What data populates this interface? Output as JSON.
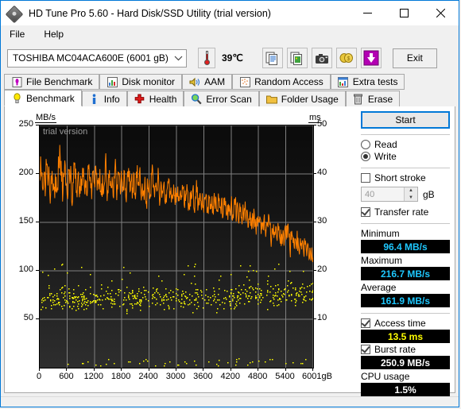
{
  "window": {
    "title": "HD Tune Pro 5.60 - Hard Disk/SSD Utility (trial version)",
    "app_icon": "hard-disk-icon",
    "minimize_label": "Minimize",
    "maximize_label": "Maximize",
    "close_label": "Close"
  },
  "menu": {
    "items": [
      {
        "label": "File"
      },
      {
        "label": "Help"
      }
    ]
  },
  "toolbar": {
    "drive": "TOSHIBA MC04ACA600E (6001 gB)",
    "drive_chevron": "chevron-down-icon",
    "temperature": "39℃",
    "thermometer_icon": "thermometer-icon",
    "buttons": [
      {
        "name": "copy-text-icon",
        "tooltip": "Copy text"
      },
      {
        "name": "copy-image-icon",
        "tooltip": "Copy image"
      },
      {
        "name": "screenshot-camera-icon",
        "tooltip": "Screenshot"
      },
      {
        "name": "buy-money-icon",
        "tooltip": "Buy"
      },
      {
        "name": "download-arrow-icon",
        "tooltip": "Download"
      }
    ],
    "exit_label": "Exit"
  },
  "tabs": {
    "row1": [
      {
        "label": "File Benchmark",
        "icon": "file-benchmark-icon",
        "active": false
      },
      {
        "label": "Disk monitor",
        "icon": "disk-monitor-icon",
        "active": false
      },
      {
        "label": "AAM",
        "icon": "speaker-icon",
        "active": false
      },
      {
        "label": "Random Access",
        "icon": "random-access-icon",
        "active": false
      },
      {
        "label": "Extra tests",
        "icon": "extra-tests-icon",
        "active": false
      }
    ],
    "row2": [
      {
        "label": "Benchmark",
        "icon": "lightbulb-icon",
        "active": true
      },
      {
        "label": "Info",
        "icon": "info-icon",
        "active": false
      },
      {
        "label": "Health",
        "icon": "health-cross-icon",
        "active": false
      },
      {
        "label": "Error Scan",
        "icon": "magnifier-icon",
        "active": false
      },
      {
        "label": "Folder Usage",
        "icon": "folder-icon",
        "active": false
      },
      {
        "label": "Erase",
        "icon": "trash-icon",
        "active": false
      }
    ]
  },
  "panel": {
    "start_label": "Start",
    "mode": {
      "read_label": "Read",
      "write_label": "Write",
      "selected": "Write"
    },
    "short_stroke": {
      "label": "Short stroke",
      "checked": false,
      "value": "40",
      "unit": "gB"
    },
    "transfer_rate": {
      "label": "Transfer rate",
      "checked": true
    },
    "minimum": {
      "label": "Minimum",
      "value": "96.4 MB/s"
    },
    "maximum": {
      "label": "Maximum",
      "value": "216.7 MB/s"
    },
    "average": {
      "label": "Average",
      "value": "161.9 MB/s"
    },
    "access_time": {
      "label": "Access time",
      "checked": true,
      "value": "13.5 ms"
    },
    "burst_rate": {
      "label": "Burst rate",
      "checked": true,
      "value": "250.9 MB/s"
    },
    "cpu_usage": {
      "label": "CPU usage",
      "value": "1.5%"
    }
  },
  "chart_data": {
    "type": "line",
    "title": "",
    "watermark": "trial version",
    "ylabel_left": "MB/s",
    "ylabel_right": "ms",
    "xlabel": "",
    "grid": true,
    "xlim": [
      0,
      6001
    ],
    "ylim_left": [
      0,
      250
    ],
    "ylim_right": [
      0,
      50
    ],
    "xticks": [
      0,
      600,
      1200,
      1800,
      2400,
      3000,
      3600,
      4200,
      4800,
      5400,
      6001
    ],
    "xtick_labels": [
      "0",
      "600",
      "1200",
      "1800",
      "2400",
      "3000",
      "3600",
      "4200",
      "4800",
      "5400",
      "6001gB"
    ],
    "yticks_left": [
      50,
      100,
      150,
      200,
      250
    ],
    "yticks_right": [
      10,
      20,
      30,
      40,
      50
    ],
    "colors": {
      "transfer_rate": "#ff8000",
      "access_time": "#ffff00",
      "grid": "#808080",
      "background": "#111111"
    },
    "series": [
      {
        "name": "Transfer rate",
        "unit": "MB/s",
        "axis": "left",
        "color": "#ff8000",
        "x": [
          0,
          30,
          60,
          90,
          120,
          150,
          180,
          210,
          240,
          270,
          300,
          330,
          360,
          390,
          420,
          450,
          480,
          510,
          540,
          570,
          600,
          630,
          660,
          690,
          720,
          750,
          780,
          810,
          840,
          870,
          900,
          930,
          960,
          990,
          1020,
          1050,
          1080,
          1110,
          1140,
          1170,
          1200,
          1230,
          1260,
          1290,
          1320,
          1350,
          1380,
          1410,
          1440,
          1470,
          1500,
          1530,
          1560,
          1590,
          1620,
          1650,
          1680,
          1710,
          1740,
          1770,
          1800,
          1830,
          1860,
          1890,
          1920,
          1950,
          1980,
          2010,
          2040,
          2070,
          2100,
          2130,
          2160,
          2190,
          2220,
          2250,
          2280,
          2310,
          2340,
          2370,
          2400,
          2430,
          2460,
          2490,
          2520,
          2550,
          2580,
          2610,
          2640,
          2670,
          2700,
          2730,
          2760,
          2790,
          2820,
          2850,
          2880,
          2910,
          2940,
          2970,
          3000,
          3030,
          3060,
          3090,
          3120,
          3150,
          3180,
          3210,
          3240,
          3270,
          3300,
          3330,
          3360,
          3390,
          3420,
          3450,
          3480,
          3510,
          3540,
          3570,
          3600,
          3630,
          3660,
          3690,
          3720,
          3750,
          3780,
          3810,
          3840,
          3870,
          3900,
          3930,
          3960,
          3990,
          4020,
          4050,
          4080,
          4110,
          4140,
          4170,
          4200,
          4230,
          4260,
          4290,
          4320,
          4350,
          4380,
          4410,
          4440,
          4470,
          4500,
          4530,
          4560,
          4590,
          4620,
          4650,
          4680,
          4710,
          4740,
          4770,
          4800,
          4830,
          4860,
          4890,
          4920,
          4950,
          4980,
          5010,
          5040,
          5070,
          5100,
          5130,
          5160,
          5190,
          5220,
          5250,
          5280,
          5310,
          5340,
          5370,
          5400,
          5430,
          5460,
          5490,
          5520,
          5550,
          5580,
          5610,
          5640,
          5670,
          5700,
          5730,
          5760,
          5790,
          5820,
          5850,
          5880,
          5910,
          5940,
          5970,
          6001
        ],
        "y": [
          193,
          204,
          186,
          198,
          177,
          209,
          188,
          196,
          181,
          203,
          190,
          175,
          197,
          186,
          208,
          216,
          192,
          180,
          201,
          188,
          178,
          205,
          190,
          196,
          172,
          212,
          195,
          183,
          200,
          176,
          198,
          188,
          206,
          179,
          193,
          185,
          210,
          197,
          174,
          202,
          190,
          208,
          183,
          196,
          205,
          178,
          199,
          187,
          213,
          192,
          180,
          204,
          188,
          197,
          175,
          206,
          190,
          184,
          201,
          179,
          195,
          187,
          203,
          176,
          198,
          206,
          182,
          193,
          186,
          200,
          174,
          196,
          188,
          202,
          179,
          190,
          183,
          197,
          171,
          185,
          194,
          178,
          200,
          186,
          176,
          191,
          183,
          195,
          172,
          188,
          180,
          192,
          169,
          183,
          191,
          175,
          186,
          178,
          189,
          168,
          180,
          187,
          172,
          183,
          176,
          186,
          165,
          178,
          183,
          170,
          181,
          174,
          184,
          163,
          176,
          181,
          168,
          178,
          172,
          180,
          160,
          174,
          178,
          166,
          175,
          169,
          177,
          158,
          171,
          175,
          163,
          172,
          166,
          174,
          155,
          168,
          172,
          160,
          169,
          163,
          170,
          152,
          164,
          168,
          156,
          165,
          159,
          166,
          148,
          159,
          163,
          151,
          160,
          154,
          161,
          143,
          154,
          158,
          147,
          155,
          150,
          156,
          138,
          149,
          153,
          142,
          150,
          145,
          151,
          133,
          144,
          148,
          137,
          145,
          140,
          146,
          128,
          138,
          142,
          131,
          139,
          134,
          140,
          122,
          132,
          136,
          126,
          133,
          128,
          134,
          117,
          126,
          130,
          120,
          127,
          122,
          128,
          112,
          120,
          124,
          114,
          121,
          116,
          122,
          106,
          114,
          118,
          108,
          115,
          110,
          116,
          100,
          108,
          112,
          104,
          110,
          98
        ]
      },
      {
        "name": "Access time",
        "unit": "ms",
        "axis": "right",
        "color": "#ffff00",
        "marker": "dot",
        "average": 13.5,
        "cluster_range_ms": [
          11,
          18
        ],
        "baseline_range_ms": [
          0.5,
          2.0
        ],
        "point_count": 620
      }
    ]
  }
}
